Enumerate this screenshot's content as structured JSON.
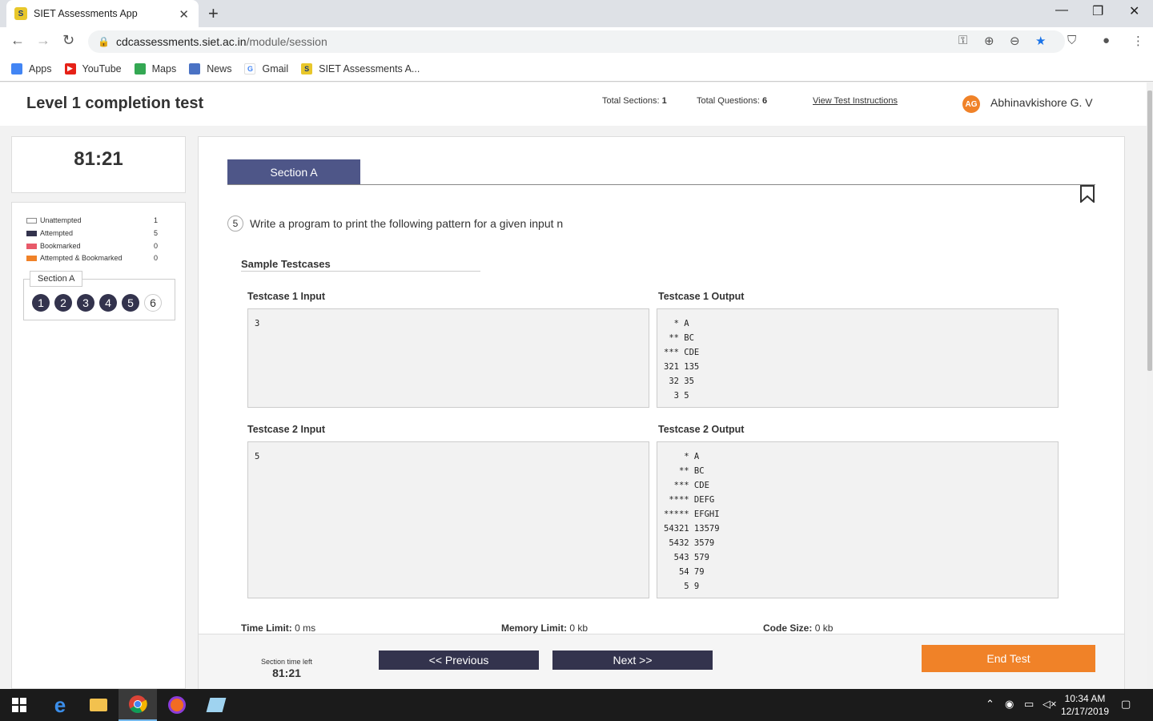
{
  "browser": {
    "tab_title": "SIET Assessments App",
    "url_host": "cdcassessments.siet.ac.in",
    "url_path": "/module/session",
    "bookmarks": [
      "Apps",
      "YouTube",
      "Maps",
      "News",
      "Gmail",
      "SIET Assessments A..."
    ]
  },
  "header": {
    "title": "Level 1 completion test",
    "total_sections_label": "Total Sections:",
    "total_sections_value": "1",
    "total_questions_label": "Total Questions:",
    "total_questions_value": "6",
    "instructions_link": "View Test Instructions",
    "avatar_initials": "AG",
    "user_name": "Abhinavkishore G. V"
  },
  "sidebar": {
    "timer": "81:21",
    "legend": [
      {
        "label": "Unattempted",
        "count": "1",
        "color": "#ffffff"
      },
      {
        "label": "Attempted",
        "count": "5",
        "color": "#33334d"
      },
      {
        "label": "Bookmarked",
        "count": "0",
        "color": "#e85a6a"
      },
      {
        "label": "Attempted & Bookmarked",
        "count": "0",
        "color": "#f08228"
      }
    ],
    "section_label": "Section A",
    "questions": [
      {
        "num": "1",
        "state": "attempted"
      },
      {
        "num": "2",
        "state": "attempted"
      },
      {
        "num": "3",
        "state": "attempted"
      },
      {
        "num": "4",
        "state": "attempted"
      },
      {
        "num": "5",
        "state": "attempted"
      },
      {
        "num": "6",
        "state": "unattempted"
      }
    ]
  },
  "main": {
    "section_tab": "Section A",
    "question_number": "5",
    "question_text": "Write a program to print the following pattern for a given input n",
    "sample_heading": "Sample Testcases",
    "testcases": [
      {
        "input_label": "Testcase 1 Input",
        "input": "3",
        "output_label": "Testcase 1 Output",
        "output": "  * A\n ** BC\n*** CDE\n321 135\n 32 35\n  3 5"
      },
      {
        "input_label": "Testcase 2 Input",
        "input": "5",
        "output_label": "Testcase 2 Output",
        "output": "    * A\n   ** BC\n  *** CDE\n **** DEFG\n***** EFGHI\n54321 13579\n 5432 3579\n  543 579\n   54 79\n    5 9"
      }
    ],
    "time_limit_label": "Time Limit:",
    "time_limit_value": "0 ms",
    "memory_limit_label": "Memory Limit:",
    "memory_limit_value": "0 kb",
    "code_size_label": "Code Size:",
    "code_size_value": "0 kb"
  },
  "footer": {
    "section_time_label": "Section time left",
    "section_time_value": "81:21",
    "previous_label": "<< Previous",
    "next_label": "Next >>",
    "end_label": "End Test"
  },
  "taskbar": {
    "time": "10:34 AM",
    "date": "12/17/2019"
  },
  "colors": {
    "accent": "#4e5688",
    "navy": "#33334d",
    "orange": "#f08228"
  }
}
